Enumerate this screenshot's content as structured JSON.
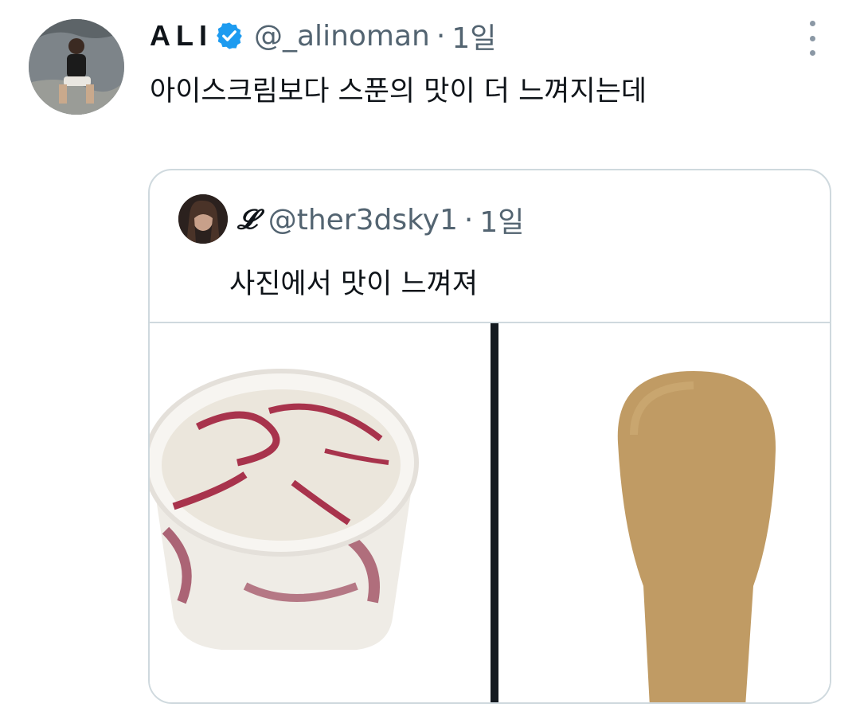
{
  "tweet": {
    "display_name": "ALI",
    "handle": "@_alinoman",
    "separator": "·",
    "time": "1일",
    "text": "아이스크림보다 스푼의 맛이 더 느껴지는데"
  },
  "quoted_tweet": {
    "display_name": "𝓛",
    "handle": "@ther3dsky1",
    "separator": "·",
    "time": "1일",
    "text": "사진에서 맛이 느껴져"
  },
  "colors": {
    "verified_badge": "#1d9bf0",
    "secondary_text": "#536471",
    "border": "#cfd9de"
  }
}
